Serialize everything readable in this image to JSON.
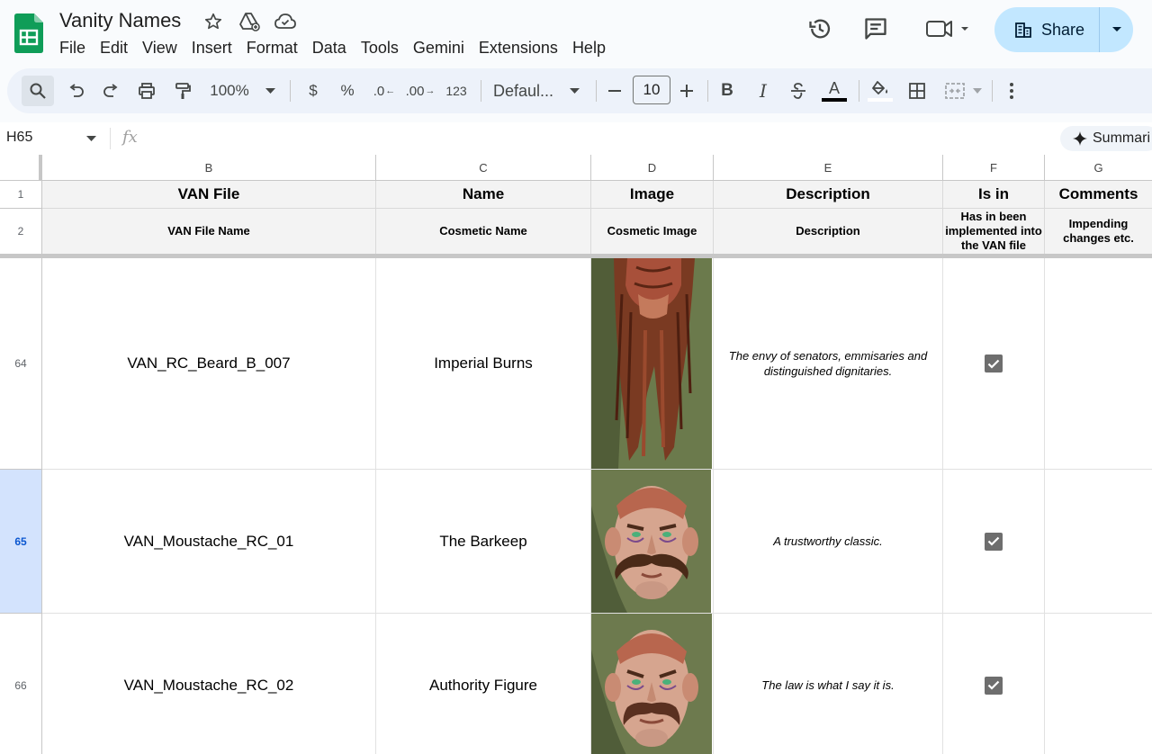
{
  "app": {
    "doc_title": "Vanity Names",
    "menu": [
      "File",
      "Edit",
      "View",
      "Insert",
      "Format",
      "Data",
      "Tools",
      "Gemini",
      "Extensions",
      "Help"
    ],
    "share_label": "Share"
  },
  "toolbar": {
    "zoom": "100%",
    "currency": "$",
    "percent": "%",
    "dec_decrease": ".0",
    "dec_increase": ".00",
    "number_format": "123",
    "font": "Defaul...",
    "font_size": "10",
    "bold": "B",
    "italic": "I",
    "text_color_letter": "A"
  },
  "formula_bar": {
    "name_box": "H65",
    "fx": "fx",
    "summarize_label": "Summari"
  },
  "columns": [
    "B",
    "C",
    "D",
    "E",
    "F",
    "G"
  ],
  "rows": [
    {
      "num": "1",
      "cells": [
        "VAN File",
        "Name",
        "Image",
        "Description",
        "Is in",
        "Comments"
      ]
    },
    {
      "num": "2",
      "cells": [
        "VAN File Name",
        "Cosmetic Name",
        "Cosmetic Image",
        "Description",
        "Has in been implemented into the VAN file",
        "Impending changes etc."
      ]
    },
    {
      "num": "64",
      "file": "VAN_RC_Beard_B_007",
      "name": "Imperial Burns",
      "description": "The envy of senators, emmisaries and distinguished dignitaries.",
      "checked": true
    },
    {
      "num": "65",
      "file": "VAN_Moustache_RC_01",
      "name": "The Barkeep",
      "description": "A trustworthy classic.",
      "checked": true
    },
    {
      "num": "66",
      "file": "VAN_Moustache_RC_02",
      "name": "Authority Figure",
      "description": "The law is what I say it is.",
      "checked": true
    }
  ],
  "colors": {
    "share_bg": "#c2e7ff",
    "toolbar_bg": "#edf2fa",
    "header_cell_bg": "#f3f3f3",
    "selected_row_bg": "#d3e3fd",
    "sheets_green": "#0f9d58",
    "image_bg": "#6d7a4e"
  }
}
